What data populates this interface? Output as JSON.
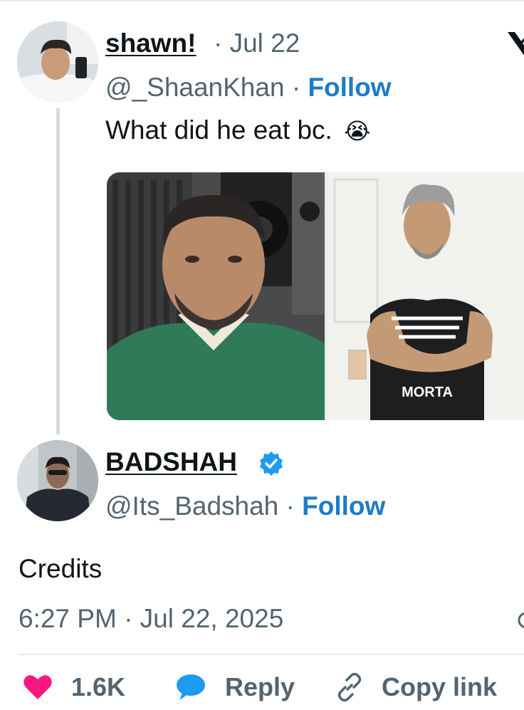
{
  "original_tweet": {
    "display_name": "shawn!",
    "separator": "·",
    "date": "Jul 22",
    "handle": "@_ShaanKhan",
    "follow_label": "Follow",
    "text": "What did he eat bc.",
    "emoji": "😭",
    "image_right_shirt_text": "MORTA"
  },
  "reply_tweet": {
    "display_name": "BADSHAH",
    "verified": true,
    "handle": "@Its_Badshah",
    "separator": "·",
    "follow_label": "Follow",
    "text": "Credits",
    "timestamp": "6:27 PM · Jul 22, 2025"
  },
  "actions": {
    "like_count": "1.6K",
    "reply_label": "Reply",
    "copy_link_label": "Copy link"
  },
  "icons": {
    "close": "x-logo-icon",
    "verified": "verified-badge-icon",
    "like": "heart-icon",
    "reply": "reply-bubble-icon",
    "copy_link": "link-icon"
  },
  "colors": {
    "link_blue": "#1d7bc9",
    "verified_blue": "#1d9bf0",
    "heart_pink": "#f91880",
    "muted_gray": "#536471",
    "text": "#0f1419"
  }
}
